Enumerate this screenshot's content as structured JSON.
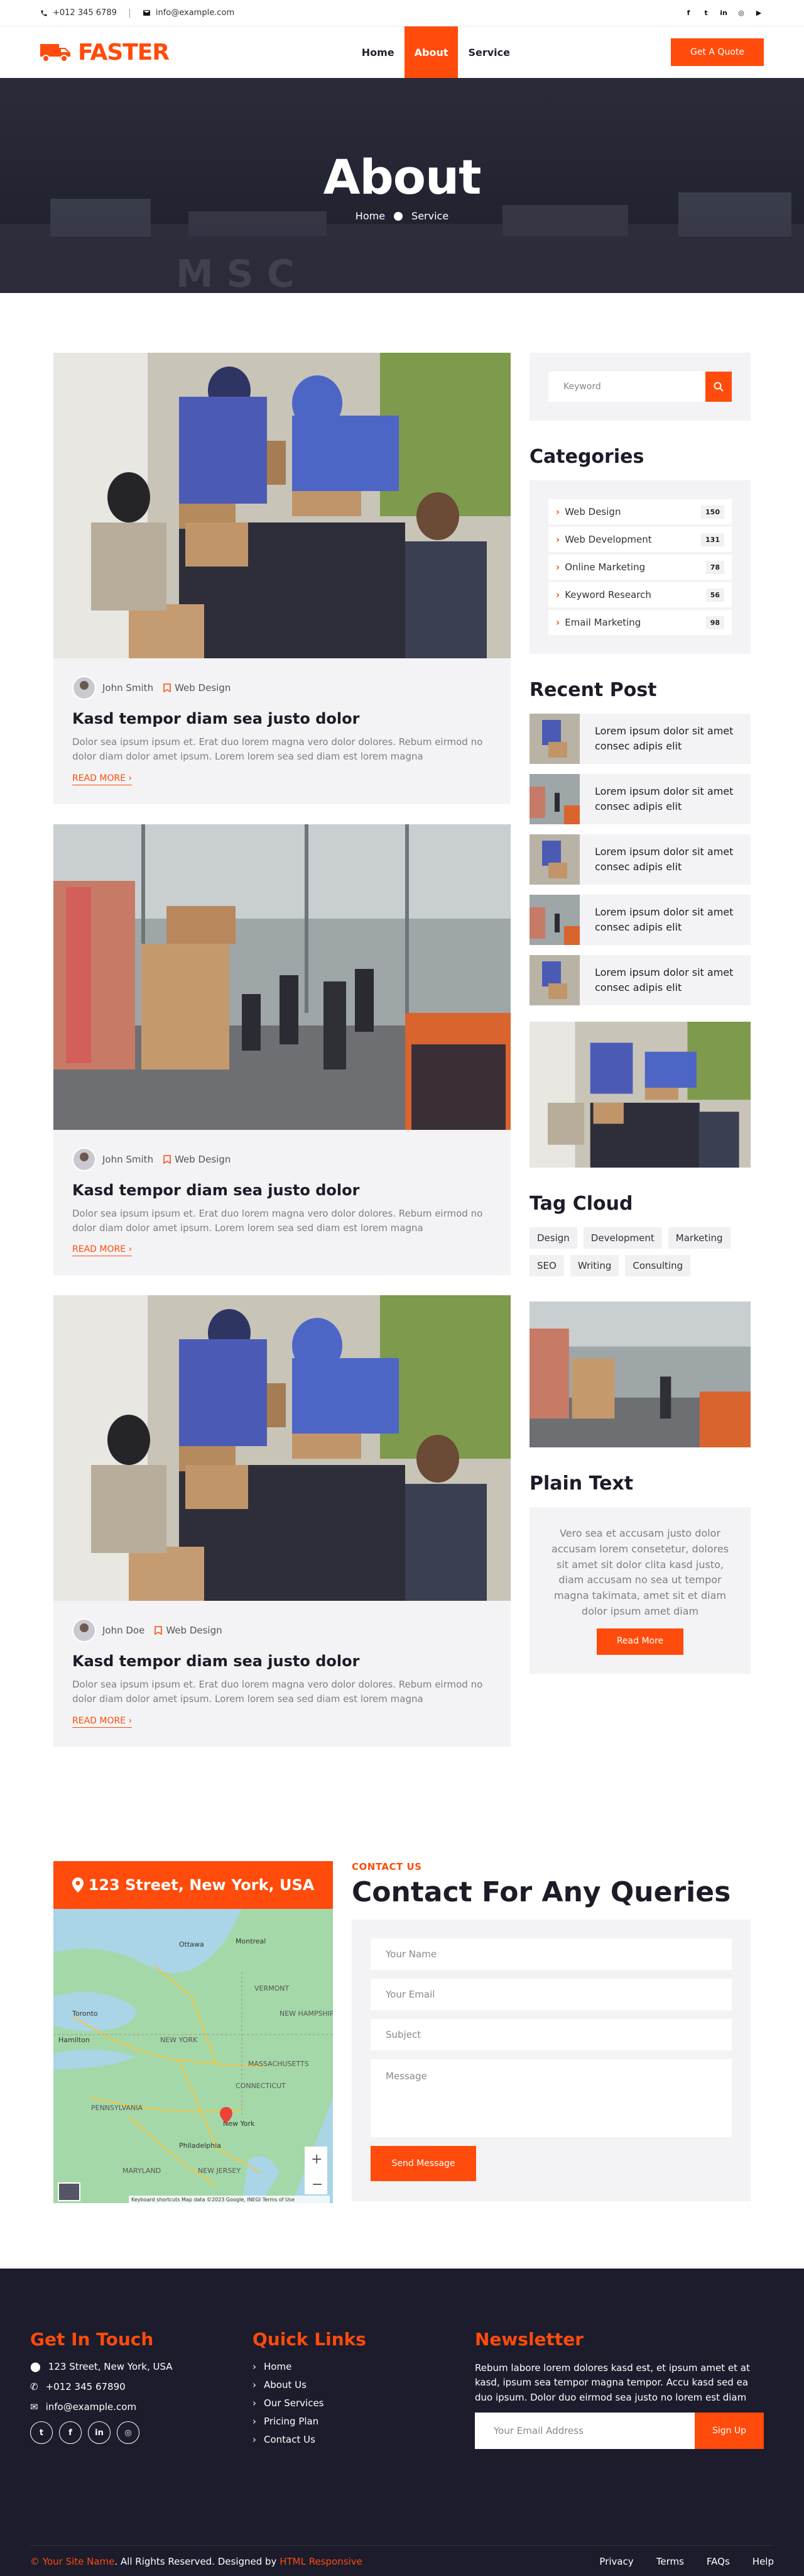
{
  "topbar": {
    "phone": "+012 345 6789",
    "email": "info@example.com",
    "socials": [
      "facebook-icon",
      "twitter-icon",
      "linkedin-icon",
      "instagram-icon",
      "youtube-icon"
    ]
  },
  "nav": {
    "logo": "FASTER",
    "items": [
      "Home",
      "About",
      "Service"
    ],
    "active": "About",
    "cta": "Get A Quote"
  },
  "hero": {
    "title": "About",
    "crumbs": [
      "Home",
      "Service"
    ]
  },
  "posts": [
    {
      "author": "John Smith",
      "category": "Web Design",
      "title": "Kasd tempor diam sea justo dolor",
      "text": "Dolor sea ipsum ipsum et. Erat duo lorem magna vero dolor dolores. Rebum eirmod no dolor diam dolor amet ipsum. Lorem lorem sea sed diam est lorem magna",
      "more": "READ MORE"
    },
    {
      "author": "John Smith",
      "category": "Web Design",
      "title": "Kasd tempor diam sea justo dolor",
      "text": "Dolor sea ipsum ipsum et. Erat duo lorem magna vero dolor dolores. Rebum eirmod no dolor diam dolor amet ipsum. Lorem lorem sea sed diam est lorem magna",
      "more": "READ MORE"
    },
    {
      "author": "John Doe",
      "category": "Web Design",
      "title": "Kasd tempor diam sea justo dolor",
      "text": "Dolor sea ipsum ipsum et. Erat duo lorem magna vero dolor dolores. Rebum eirmod no dolor diam dolor amet ipsum. Lorem lorem sea sed diam est lorem magna",
      "more": "READ MORE"
    }
  ],
  "sidebar": {
    "search_placeholder": "Keyword",
    "categories_title": "Categories",
    "categories": [
      {
        "label": "Web Design",
        "count": "150"
      },
      {
        "label": "Web Development",
        "count": "131"
      },
      {
        "label": "Online Marketing",
        "count": "78"
      },
      {
        "label": "Keyword Research",
        "count": "56"
      },
      {
        "label": "Email Marketing",
        "count": "98"
      }
    ],
    "recent_title": "Recent Post",
    "recent": [
      "Lorem ipsum dolor sit amet consec adipis elit",
      "Lorem ipsum dolor sit amet consec adipis elit",
      "Lorem ipsum dolor sit amet consec adipis elit",
      "Lorem ipsum dolor sit amet consec adipis elit",
      "Lorem ipsum dolor sit amet consec adipis elit"
    ],
    "tag_title": "Tag Cloud",
    "tags": [
      "Design",
      "Development",
      "Marketing",
      "SEO",
      "Writing",
      "Consulting"
    ],
    "plain_title": "Plain Text",
    "plain_text": "Vero sea et accusam justo dolor accusam lorem consetetur, dolores sit amet sit dolor clita kasd justo, diam accusam no sea ut tempor magna takimata, amet sit et diam dolor ipsum amet diam",
    "plain_button": "Read More"
  },
  "contact": {
    "address": "123 Street, New York, USA",
    "small": "CONTACT US",
    "title": "Contact For Any Queries",
    "fields": [
      "Your Name",
      "Your Email",
      "Subject",
      "Message"
    ],
    "send": "Send Message",
    "map_labels": {
      "ottawa": "Ottawa",
      "montreal": "Montreal",
      "toronto": "Toronto",
      "hamilton": "Hamilton",
      "new_york_state": "NEW YORK",
      "vermont": "VERMONT",
      "new_hampshire": "NEW HAMPSHIRE",
      "massachusetts": "MASSACHUSETTS",
      "connecticut": "CONNECTICUT",
      "pennsylvania": "PENNSYLVANIA",
      "new_york": "New York",
      "philadelphia": "Philadelphia",
      "maryland": "MARYLAND",
      "new_jersey": "NEW JERSEY",
      "attribution": "Keyboard shortcuts   Map data ©2023 Google, INEGI   Terms of Use"
    }
  },
  "footer": {
    "touch_title": "Get In Touch",
    "address": "123 Street, New York, USA",
    "phone": "+012 345 67890",
    "email": "info@example.com",
    "links_title": "Quick Links",
    "links": [
      "Home",
      "About Us",
      "Our Services",
      "Pricing Plan",
      "Contact Us"
    ],
    "news_title": "Newsletter",
    "news_text": "Rebum labore lorem dolores kasd est, et ipsum amet et at kasd, ipsum sea tempor magna tempor. Accu kasd sed ea duo ipsum. Dolor duo eirmod sea justo no lorem est diam",
    "news_placeholder": "Your Email Address",
    "news_button": "Sign Up",
    "copy_prefix": "©",
    "site": "Your Site Name",
    "rights": ". All Rights Reserved. Designed by",
    "designer": "HTML Responsive",
    "bottom_links": [
      "Privacy",
      "Terms",
      "FAQs",
      "Help"
    ]
  },
  "colors": {
    "accent": "#ff4b0b",
    "dark": "#1c1c2d",
    "light": "#f3f3f5"
  }
}
